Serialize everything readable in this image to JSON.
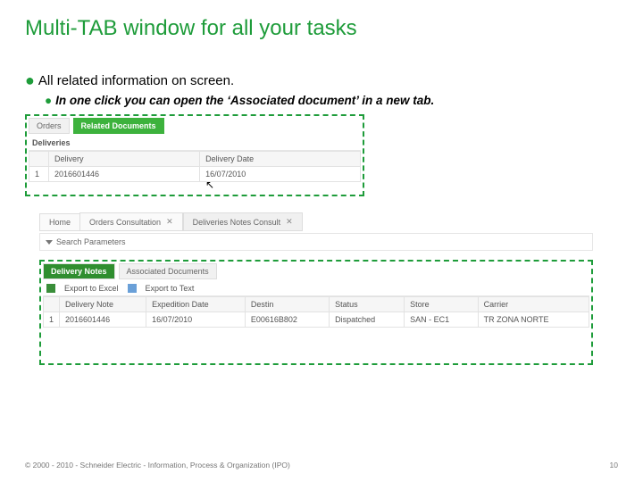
{
  "title": "Multi-TAB window for all your tasks",
  "bullets": {
    "l1": "All related information on screen.",
    "l2": "In one click you can open the ‘Associated document’ in a new tab."
  },
  "panel1": {
    "tabs": {
      "t1": "Orders",
      "t2": "Related Documents"
    },
    "section": "Deliveries",
    "cols": {
      "c0": "",
      "c1": "Delivery",
      "c2": "Delivery Date"
    },
    "row": {
      "n": "1",
      "c1": "2016601446",
      "c2": "16/07/2010"
    }
  },
  "browserTabs": {
    "home": "Home",
    "t1": "Orders Consultation",
    "t2": "Deliveries Notes Consult"
  },
  "searchBar": {
    "icon": "▾",
    "label": "Search Parameters"
  },
  "panel2": {
    "tabs": {
      "t1": "Delivery Notes",
      "t2": "Associated Documents"
    },
    "toolbar": {
      "a": "Export to Excel",
      "b": "Export to Text"
    },
    "cols": {
      "c0": "",
      "c1": "Delivery Note",
      "c2": "Expedition Date",
      "c3": "Destin",
      "c4": "Status",
      "c5": "Store",
      "c6": "Carrier"
    },
    "row": {
      "n": "1",
      "c1": "2016601446",
      "c2": "16/07/2010",
      "c3": "E00616B802",
      "c4": "Dispatched",
      "c5": "SAN - EC1",
      "c6": "TR ZONA NORTE"
    }
  },
  "footer": {
    "left": "© 2000 - 2010 - Schneider Electric - Information, Process & Organization (IPO)",
    "page": "10"
  }
}
